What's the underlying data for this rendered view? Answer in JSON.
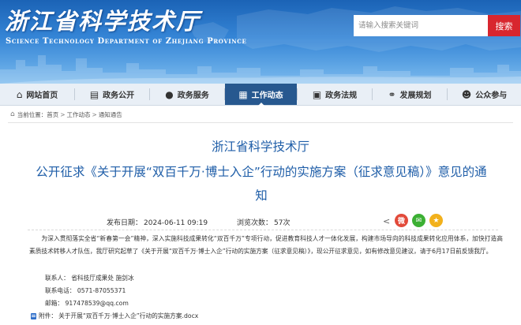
{
  "site": {
    "title": "浙江省科学技术厅",
    "subtitle": "Science Technology Department of Zhejiang Province"
  },
  "search": {
    "placeholder": "请输入搜索关键词",
    "button_label": "搜索"
  },
  "nav": {
    "items": [
      {
        "label": "网站首页",
        "icon": "home-icon"
      },
      {
        "label": "政务公开",
        "icon": "book-icon"
      },
      {
        "label": "政务服务",
        "icon": "chat-bubble-icon"
      },
      {
        "label": "工作动态",
        "icon": "calendar-icon",
        "active": true
      },
      {
        "label": "政务法规",
        "icon": "document-icon"
      },
      {
        "label": "发展规划",
        "icon": "handshake-icon"
      },
      {
        "label": "公众参与",
        "icon": "people-icon"
      }
    ]
  },
  "breadcrumb": {
    "prefix": "当前位置：",
    "items": [
      "首页",
      "工作动态",
      "通知通告"
    ],
    "separator": ">"
  },
  "article": {
    "org": "浙江省科学技术厅",
    "title": "公开征求《关于开展“双百千万·博士入企”行动的实施方案（征求意见稿）》意见的通知",
    "date_label": "发布日期：",
    "date": "2024-06-11 09:19",
    "views_label": "浏览次数：",
    "views": "57次",
    "body": "为深入贯彻落实全省“新春第一会”精神，深入实施科技成果转化“双百千万”专项行动，促进教育科技人才一体化发展，构建市场导向的科技成果转化应用体系，加快打造高素质技术转移人才队伍，我厅研究起草了《关于开展“双百千万·博士入企”行动的实施方案（征求意见稿）》，现公开征求意见，如有修改意见建议，请于6月17日前反馈我厅。",
    "contact_unit": "联系人：    省科技厅成果处 施剑冰",
    "contact_phone": "联系电话：  0571-87055371",
    "contact_email": "邮箱：  917478539@qq.com",
    "attachment_label": "附件：",
    "attachment_name": "关于开展“双百千万·博士入企”行动的实施方案.docx"
  },
  "share": {
    "icons": [
      "share-icon",
      "weibo-icon",
      "wechat-icon",
      "qzone-icon"
    ]
  },
  "colors": {
    "banner_blue": "#2a74c7",
    "nav_active": "#27588f",
    "title_blue": "#1f5ea8",
    "search_red": "#d8262e"
  }
}
